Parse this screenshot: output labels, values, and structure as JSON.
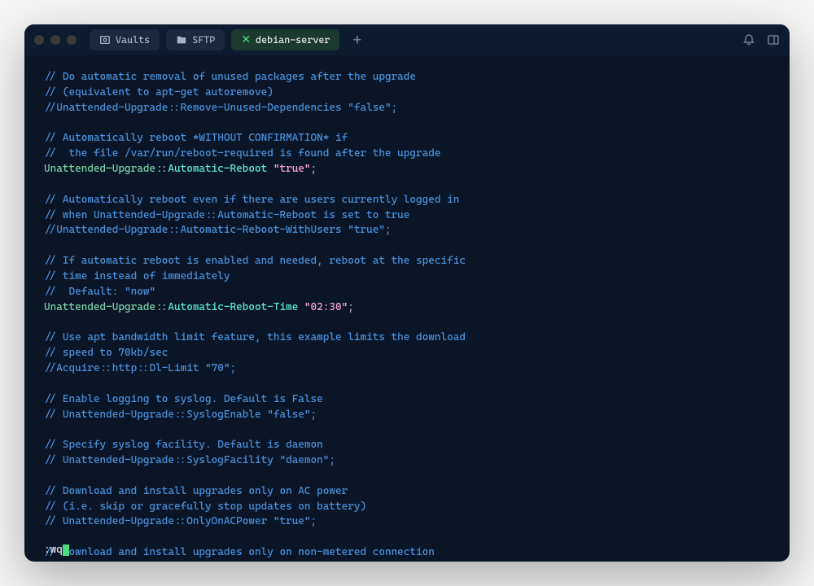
{
  "titlebar": {
    "tabs": {
      "vaults": "Vaults",
      "sftp": "SFTP",
      "active": "debian-server"
    }
  },
  "code": {
    "l1": "// Do automatic removal of unused packages after the upgrade",
    "l2": "// (equivalent to apt-get autoremove)",
    "l3": "//Unattended-Upgrade::Remove-Unused-Dependencies \"false\";",
    "l5": "// Automatically reboot *WITHOUT CONFIRMATION* if",
    "l6": "//  the file /var/run/reboot-required is found after the upgrade",
    "l7a": "Unattended-Upgrade",
    "l7b": "::",
    "l7c": "Automatic-Reboot",
    "l7d": " \"true\"",
    "l7e": ";",
    "l9": "// Automatically reboot even if there are users currently logged in",
    "l10": "// when Unattended-Upgrade::Automatic-Reboot is set to true",
    "l11": "//Unattended-Upgrade::Automatic-Reboot-WithUsers \"true\";",
    "l13": "// If automatic reboot is enabled and needed, reboot at the specific",
    "l14": "// time instead of immediately",
    "l15": "//  Default: \"now\"",
    "l16a": "Unattended-Upgrade",
    "l16b": "::",
    "l16c": "Automatic-Reboot-Time",
    "l16d": " \"02:30\"",
    "l16e": ";",
    "l18": "// Use apt bandwidth limit feature, this example limits the download",
    "l19": "// speed to 70kb/sec",
    "l20": "//Acquire::http::Dl-Limit \"70\";",
    "l22": "// Enable logging to syslog. Default is False",
    "l23": "// Unattended-Upgrade::SyslogEnable \"false\";",
    "l25": "// Specify syslog facility. Default is daemon",
    "l26": "// Unattended-Upgrade::SyslogFacility \"daemon\";",
    "l28": "// Download and install upgrades only on AC power",
    "l29": "// (i.e. skip or gracefully stop updates on battery)",
    "l30": "// Unattended-Upgrade::OnlyOnACPower \"true\";",
    "l32": "// Download and install upgrades only on non-metered connection"
  },
  "cmdline": ":wq"
}
